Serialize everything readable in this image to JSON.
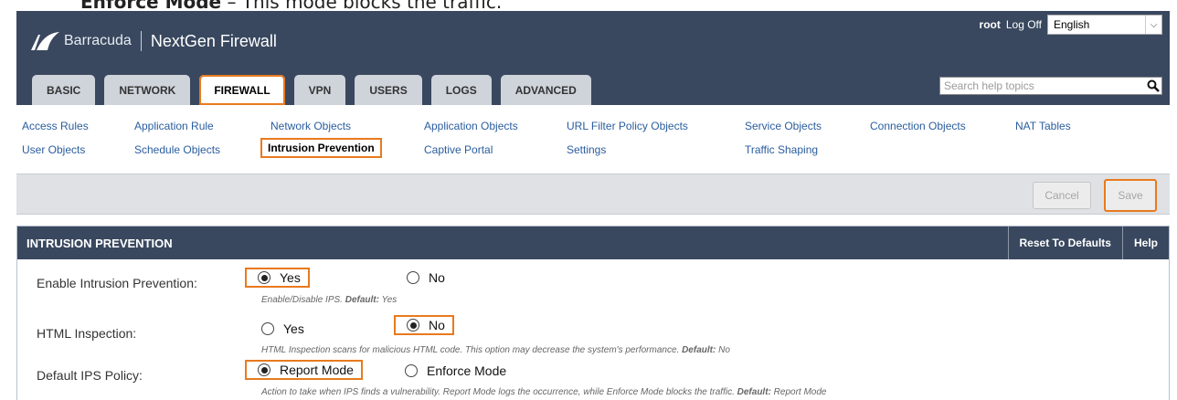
{
  "doc_text": {
    "term": "Enforce Mode",
    "desc": "– This mode blocks the traffic."
  },
  "header": {
    "brand": "Barracuda",
    "product": "NextGen Firewall",
    "user": "root",
    "logoff": "Log Off",
    "language": "English",
    "search_placeholder": "Search help topics"
  },
  "tabs": [
    {
      "label": "BASIC"
    },
    {
      "label": "NETWORK"
    },
    {
      "label": "FIREWALL"
    },
    {
      "label": "VPN"
    },
    {
      "label": "USERS"
    },
    {
      "label": "LOGS"
    },
    {
      "label": "ADVANCED"
    }
  ],
  "subnav": [
    "Access Rules",
    "Application Rule",
    "Network Objects",
    "Application Objects",
    "URL Filter Policy Objects",
    "Service Objects",
    "Connection Objects",
    "NAT Tables",
    "User Objects",
    "Schedule Objects",
    "Intrusion Prevention",
    "Captive Portal",
    "Settings",
    "Traffic Shaping"
  ],
  "actions": {
    "cancel": "Cancel",
    "save": "Save"
  },
  "panel": {
    "title": "INTRUSION PREVENTION",
    "reset": "Reset To Defaults",
    "help": "Help",
    "rows": [
      {
        "label": "Enable Intrusion Prevention:",
        "opt1": "Yes",
        "opt2": "No",
        "selected": "Yes",
        "hint_text": "Enable/Disable IPS.",
        "hint_default_label": "Default:",
        "hint_default": "Yes"
      },
      {
        "label": "HTML Inspection:",
        "opt1": "Yes",
        "opt2": "No",
        "selected": "No",
        "hint_text": "HTML Inspection scans for malicious HTML code. This option may decrease the system's performance.",
        "hint_default_label": "Default:",
        "hint_default": "No"
      },
      {
        "label": "Default IPS Policy:",
        "opt1": "Report Mode",
        "opt2": "Enforce Mode",
        "selected": "Report Mode",
        "hint_text": "Action to take when IPS finds a vulnerability. Report Mode logs the occurrence, while Enforce Mode blocks the traffic.",
        "hint_default_label": "Default:",
        "hint_default": "Report Mode"
      }
    ]
  },
  "colors": {
    "header_bg": "#39485f",
    "highlight": "#e87a1e",
    "link": "#2a5d9e"
  }
}
